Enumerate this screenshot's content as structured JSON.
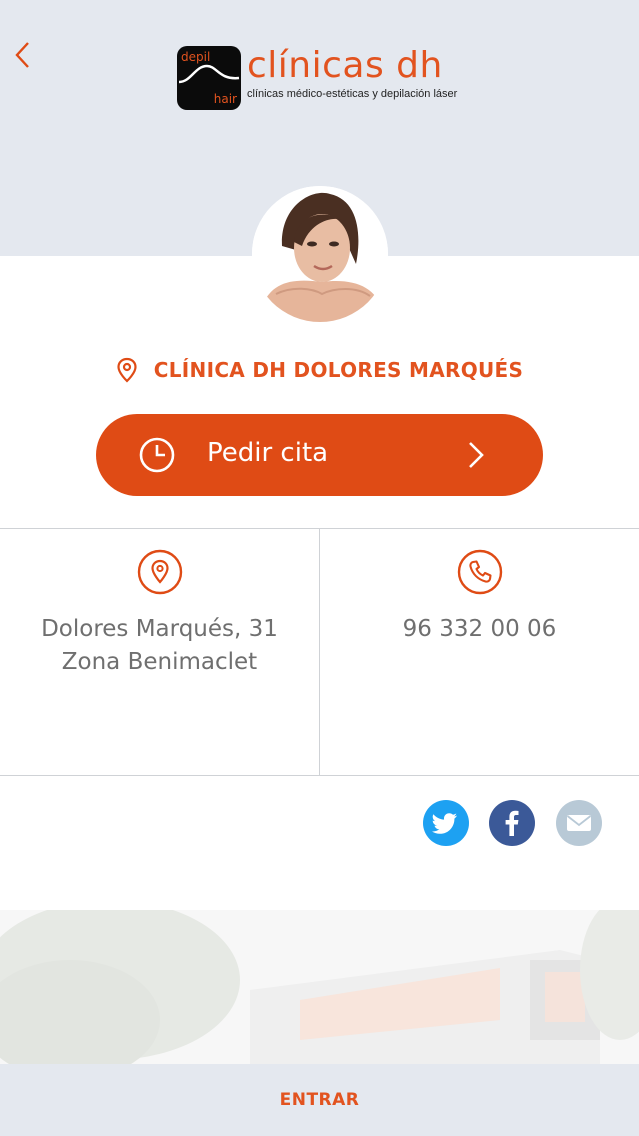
{
  "colors": {
    "accent": "#df4b15",
    "header_bg": "#e4e8ef",
    "text_gray": "#6f6f6f",
    "twitter": "#1da1f2",
    "facebook": "#3b5998",
    "mail": "#b8c9d6"
  },
  "header": {
    "back_icon": "chevron-left-icon",
    "logo": {
      "mark_word_top": "depil",
      "mark_word_bottom": "hair",
      "title": "clínicas dh",
      "subtitle": "clínicas médico-estéticas y depilación láser"
    }
  },
  "clinic": {
    "pin_icon": "location-pin-icon",
    "name": "CLÍNICA DH DOLORES MARQUÉS"
  },
  "cta": {
    "icon": "clock-icon",
    "label": "Pedir cita",
    "chevron": "chevron-right-icon"
  },
  "info": {
    "address": {
      "icon": "location-pin-icon",
      "line1": "Dolores Marqués, 31",
      "line2": "Zona Benimaclet"
    },
    "phone": {
      "icon": "phone-icon",
      "number": "96 332 00 06"
    }
  },
  "social": [
    {
      "name": "twitter",
      "icon": "twitter-icon"
    },
    {
      "name": "facebook",
      "icon": "facebook-icon"
    },
    {
      "name": "email",
      "icon": "mail-icon"
    }
  ],
  "footer": {
    "label": "ENTRAR"
  }
}
